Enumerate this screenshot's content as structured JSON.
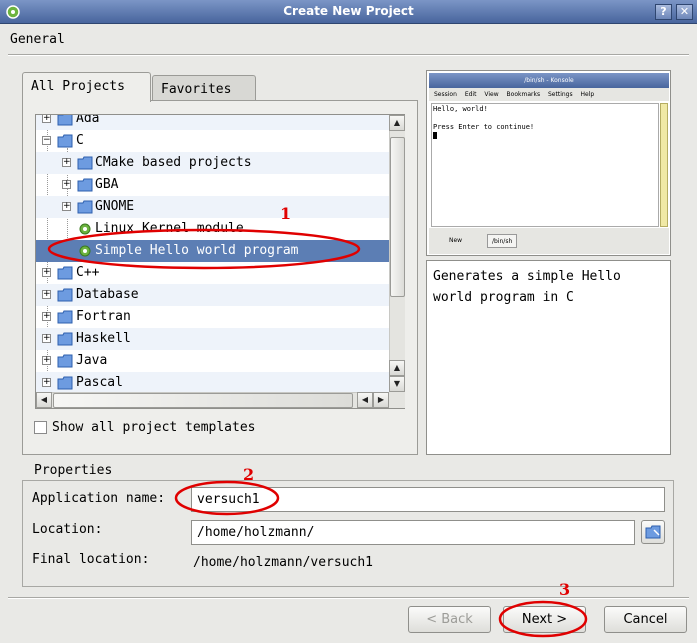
{
  "window": {
    "title": "Create New Project",
    "help_button": "?",
    "close_button": "✕"
  },
  "section": {
    "title": "General"
  },
  "tabs": [
    {
      "label": "All Projects",
      "accel": "A"
    },
    {
      "label": "Favorites",
      "accel": "F"
    }
  ],
  "tree": {
    "items": [
      {
        "label": "Ada",
        "level": 0,
        "expander": "+"
      },
      {
        "label": "C",
        "level": 0,
        "expander": "−"
      },
      {
        "label": "CMake based projects",
        "level": 1,
        "expander": "+"
      },
      {
        "label": "GBA",
        "level": 1,
        "expander": "+"
      },
      {
        "label": "GNOME",
        "level": 1,
        "expander": "+"
      },
      {
        "label": "Linux Kernel module",
        "level": 1,
        "expander": ""
      },
      {
        "label": "Simple Hello world program",
        "level": 1,
        "expander": "",
        "selected": true
      },
      {
        "label": "C++",
        "level": 0,
        "expander": "+"
      },
      {
        "label": "Database",
        "level": 0,
        "expander": "+"
      },
      {
        "label": "Fortran",
        "level": 0,
        "expander": "+"
      },
      {
        "label": "Haskell",
        "level": 0,
        "expander": "+"
      },
      {
        "label": "Java",
        "level": 0,
        "expander": "+"
      },
      {
        "label": "Pascal",
        "level": 0,
        "expander": "+"
      }
    ]
  },
  "show_all_templates": {
    "label": "Show all project templates",
    "checked": false
  },
  "preview": {
    "window_title": "/bin/sh - Konsole",
    "menu": [
      "Session",
      "Edit",
      "View",
      "Bookmarks",
      "Settings",
      "Help"
    ],
    "terminal_lines": [
      "Hello, world!",
      "",
      "Press Enter to continue!"
    ],
    "tab_new": "New",
    "tab_shell": "/bin/sh"
  },
  "description": "Generates a simple Hello world program in C",
  "properties": {
    "title": "Properties",
    "app_name_label": "Application name:",
    "app_name_value": "versuch1",
    "location_label": "Location:",
    "location_value": "/home/holzmann/",
    "final_location_label": "Final location:",
    "final_location_value": "/home/holzmann/versuch1"
  },
  "buttons": {
    "back": "< Back",
    "next": "Next >",
    "cancel": "Cancel"
  },
  "annotations": {
    "step1": "1",
    "step2": "2",
    "step3": "3"
  },
  "colors": {
    "annotation": "#e00000",
    "selection": "#5c7eb4",
    "titlebar": "#48659d"
  }
}
